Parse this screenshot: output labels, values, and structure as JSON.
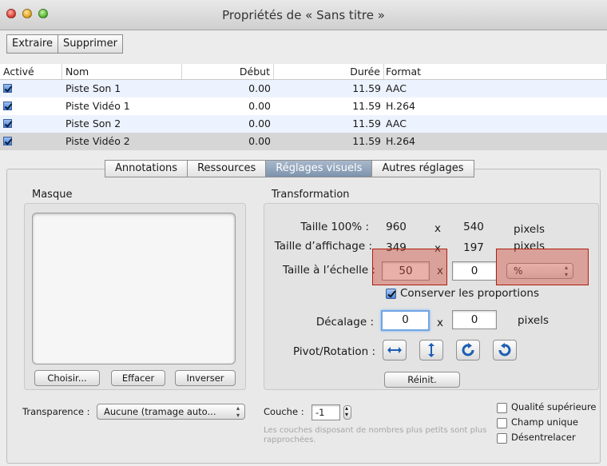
{
  "window": {
    "title": "Propriétés de « Sans titre »"
  },
  "toolbar": {
    "extract_label": "Extraire",
    "delete_label": "Supprimer"
  },
  "tracks": {
    "headers": [
      "Activé",
      "Nom",
      "Début",
      "Durée",
      "Format"
    ],
    "rows": [
      {
        "name": "Piste Son 1",
        "start": "0.00",
        "duration": "11.59",
        "format": "AAC"
      },
      {
        "name": "Piste Vidéo 1",
        "start": "0.00",
        "duration": "11.59",
        "format": "H.264"
      },
      {
        "name": "Piste Son 2",
        "start": "0.00",
        "duration": "11.59",
        "format": "AAC"
      },
      {
        "name": "Piste Vidéo 2",
        "start": "0.00",
        "duration": "11.59",
        "format": "H.264"
      }
    ]
  },
  "tabs": [
    "Annotations",
    "Ressources",
    "Réglages visuels",
    "Autres réglages"
  ],
  "masque": {
    "label": "Masque",
    "choose_label": "Choisir...",
    "clear_label": "Effacer",
    "invert_label": "Inverser"
  },
  "transformation": {
    "label": "Transformation",
    "size100_label": "Taille 100% :",
    "size100_w": "960",
    "size100_h": "540",
    "display_label": "Taille d’affichage :",
    "display_w": "349",
    "display_h": "197",
    "scale_label": "Taille à l’échelle :",
    "scale_w": "50",
    "scale_h": "0",
    "scale_unit": "%",
    "keep_proportions": "Conserver les proportions",
    "offset_label": "Décalage :",
    "offset_x": "0",
    "offset_y": "0",
    "pivot_label": "Pivot/Rotation :",
    "reset_label": "Réinit.",
    "times": "x",
    "pixels": "pixels"
  },
  "bottom": {
    "transparency_label": "Transparence :",
    "transparency_value": "Aucune (tramage auto...",
    "layer_label": "Couche :",
    "layer_value": "-1",
    "layer_note": "Les couches disposant de nombres plus petits sont plus rapprochées.",
    "high_quality": "Qualité supérieure",
    "single_field": "Champ unique",
    "deinterlace": "Désentrelacer"
  },
  "colors": {
    "selection_tab": "#8da0b8",
    "highlight": "#c8503f",
    "focus": "#6fa6e6"
  }
}
